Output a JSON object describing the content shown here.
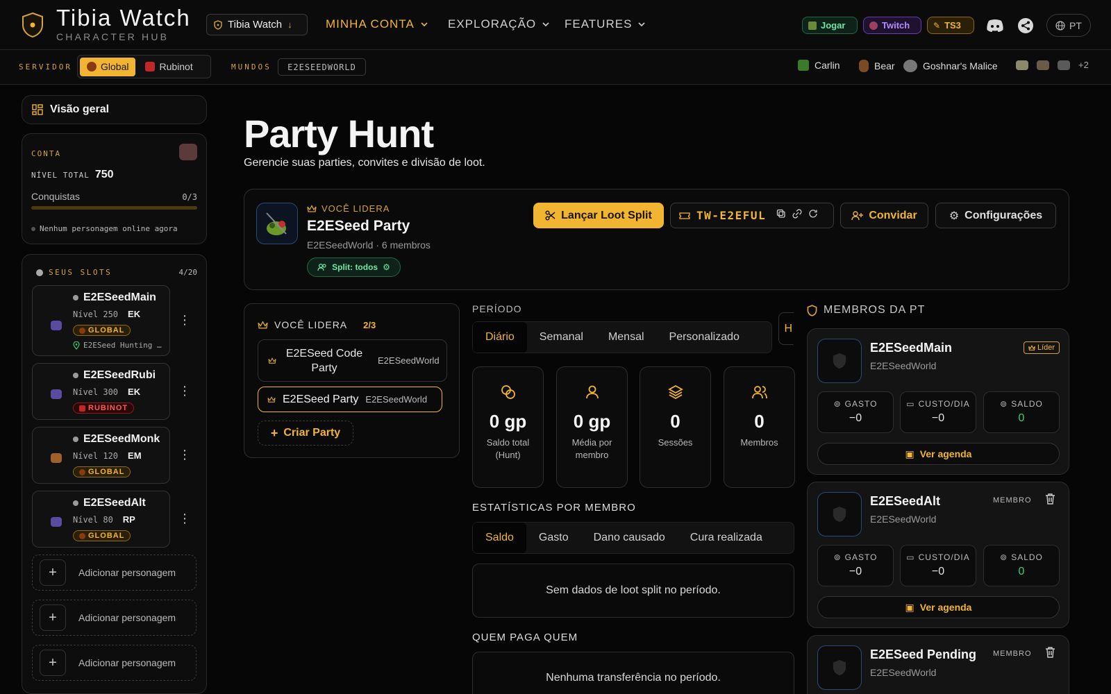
{
  "header": {
    "brand_title": "Tibia Watch",
    "brand_sub": "CHARACTER HUB",
    "world_select": "Tibia Watch",
    "nav": [
      {
        "label": "MINHA CONTA",
        "active": true
      },
      {
        "label": "EXPLORAÇÃO",
        "active": false
      },
      {
        "label": "FEATURES",
        "active": false
      }
    ],
    "jogar": "Jogar",
    "twitch": "Twitch",
    "ts3": "TS3",
    "lang": "PT"
  },
  "subbar": {
    "servidor_label": "SERVIDOR",
    "servers": [
      "Global",
      "Rubinot"
    ],
    "mundos_label": "MUNDOS",
    "world": "E2ESEEDWORLD",
    "bosses": [
      "Carlin",
      "Bear",
      "Goshnar's Malice"
    ],
    "more": "+2"
  },
  "sidebar": {
    "overview": "Visão geral",
    "conta_label": "CONTA",
    "nivel_label": "NÍVEL TOTAL",
    "nivel_value": "750",
    "conquistas_label": "Conquistas",
    "conquistas_value": "0/3",
    "conquistas_progress": 0,
    "online_status": "Nenhum personagem online agora",
    "slots_label": "SEUS SLOTS",
    "slots_count": "4/20",
    "slots": [
      {
        "name": "E2ESeedMain",
        "level": "Nível 250",
        "voc": "EK",
        "server": "GLOBAL",
        "location": "E2ESeed Hunting …"
      },
      {
        "name": "E2ESeedRubi",
        "level": "Nível 300",
        "voc": "EK",
        "server": "RUBINOT"
      },
      {
        "name": "E2ESeedMonk",
        "level": "Nível 120",
        "voc": "EM",
        "server": "GLOBAL"
      },
      {
        "name": "E2ESeedAlt",
        "level": "Nível 80",
        "voc": "RP",
        "server": "GLOBAL"
      }
    ],
    "add_label": "Adicionar personagem"
  },
  "main": {
    "title": "Party Hunt",
    "subtitle": "Gerencie suas parties, convites e divisão de loot.",
    "party": {
      "leader_label": "VOCÊ LIDERA",
      "name": "E2ESeed Party",
      "meta": "E2ESeedWorld · 6 membros",
      "split_badge": "Split: todos",
      "launch_btn": "Lançar Loot Split",
      "code": "TW-E2EFUL",
      "invite_btn": "Convidar",
      "settings_btn": "Configurações"
    },
    "lead_list": {
      "label": "VOCÊ LIDERA",
      "count": "2/3",
      "items": [
        {
          "name": "E2ESeed Code Party",
          "world": "E2ESeedWorld",
          "selected": false
        },
        {
          "name": "E2ESeed Party",
          "world": "E2ESeedWorld",
          "selected": true
        }
      ],
      "create_btn": "Criar Party"
    },
    "periodo_label": "PERÍODO",
    "period_tabs": [
      "Diário",
      "Semanal",
      "Mensal",
      "Personalizado"
    ],
    "overflow_btn": "H",
    "stats": [
      {
        "value": "0 gp",
        "label": "Saldo total (Hunt)"
      },
      {
        "value": "0 gp",
        "label": "Média por membro"
      },
      {
        "value": "0",
        "label": "Sessões"
      },
      {
        "value": "0",
        "label": "Membros"
      }
    ],
    "member_stats_label": "ESTATÍSTICAS POR MEMBRO",
    "member_tabs": [
      "Saldo",
      "Gasto",
      "Dano causado",
      "Cura realizada"
    ],
    "no_data": "Sem dados de loot split no período.",
    "quem_paga_label": "QUEM PAGA QUEM",
    "no_transfer": "Nenhuma transferência no período."
  },
  "members": {
    "label": "MEMBROS DA PT",
    "stat_labels": [
      "GASTO",
      "CUSTO/DIA",
      "SALDO"
    ],
    "agenda_btn": "Ver agenda",
    "items": [
      {
        "name": "E2ESeedMain",
        "world": "E2ESeedWorld",
        "role": "Líder",
        "gasto": "−0",
        "custo": "−0",
        "saldo": "0"
      },
      {
        "name": "E2ESeedAlt",
        "world": "E2ESeedWorld",
        "role": "MEMBRO",
        "gasto": "−0",
        "custo": "−0",
        "saldo": "0"
      },
      {
        "name": "E2ESeed Pending",
        "world": "E2ESeedWorld",
        "role": "MEMBRO"
      }
    ]
  },
  "colors": {
    "accent": "#f2b532",
    "green": "#34d17a",
    "red": "#ff5a5a"
  }
}
